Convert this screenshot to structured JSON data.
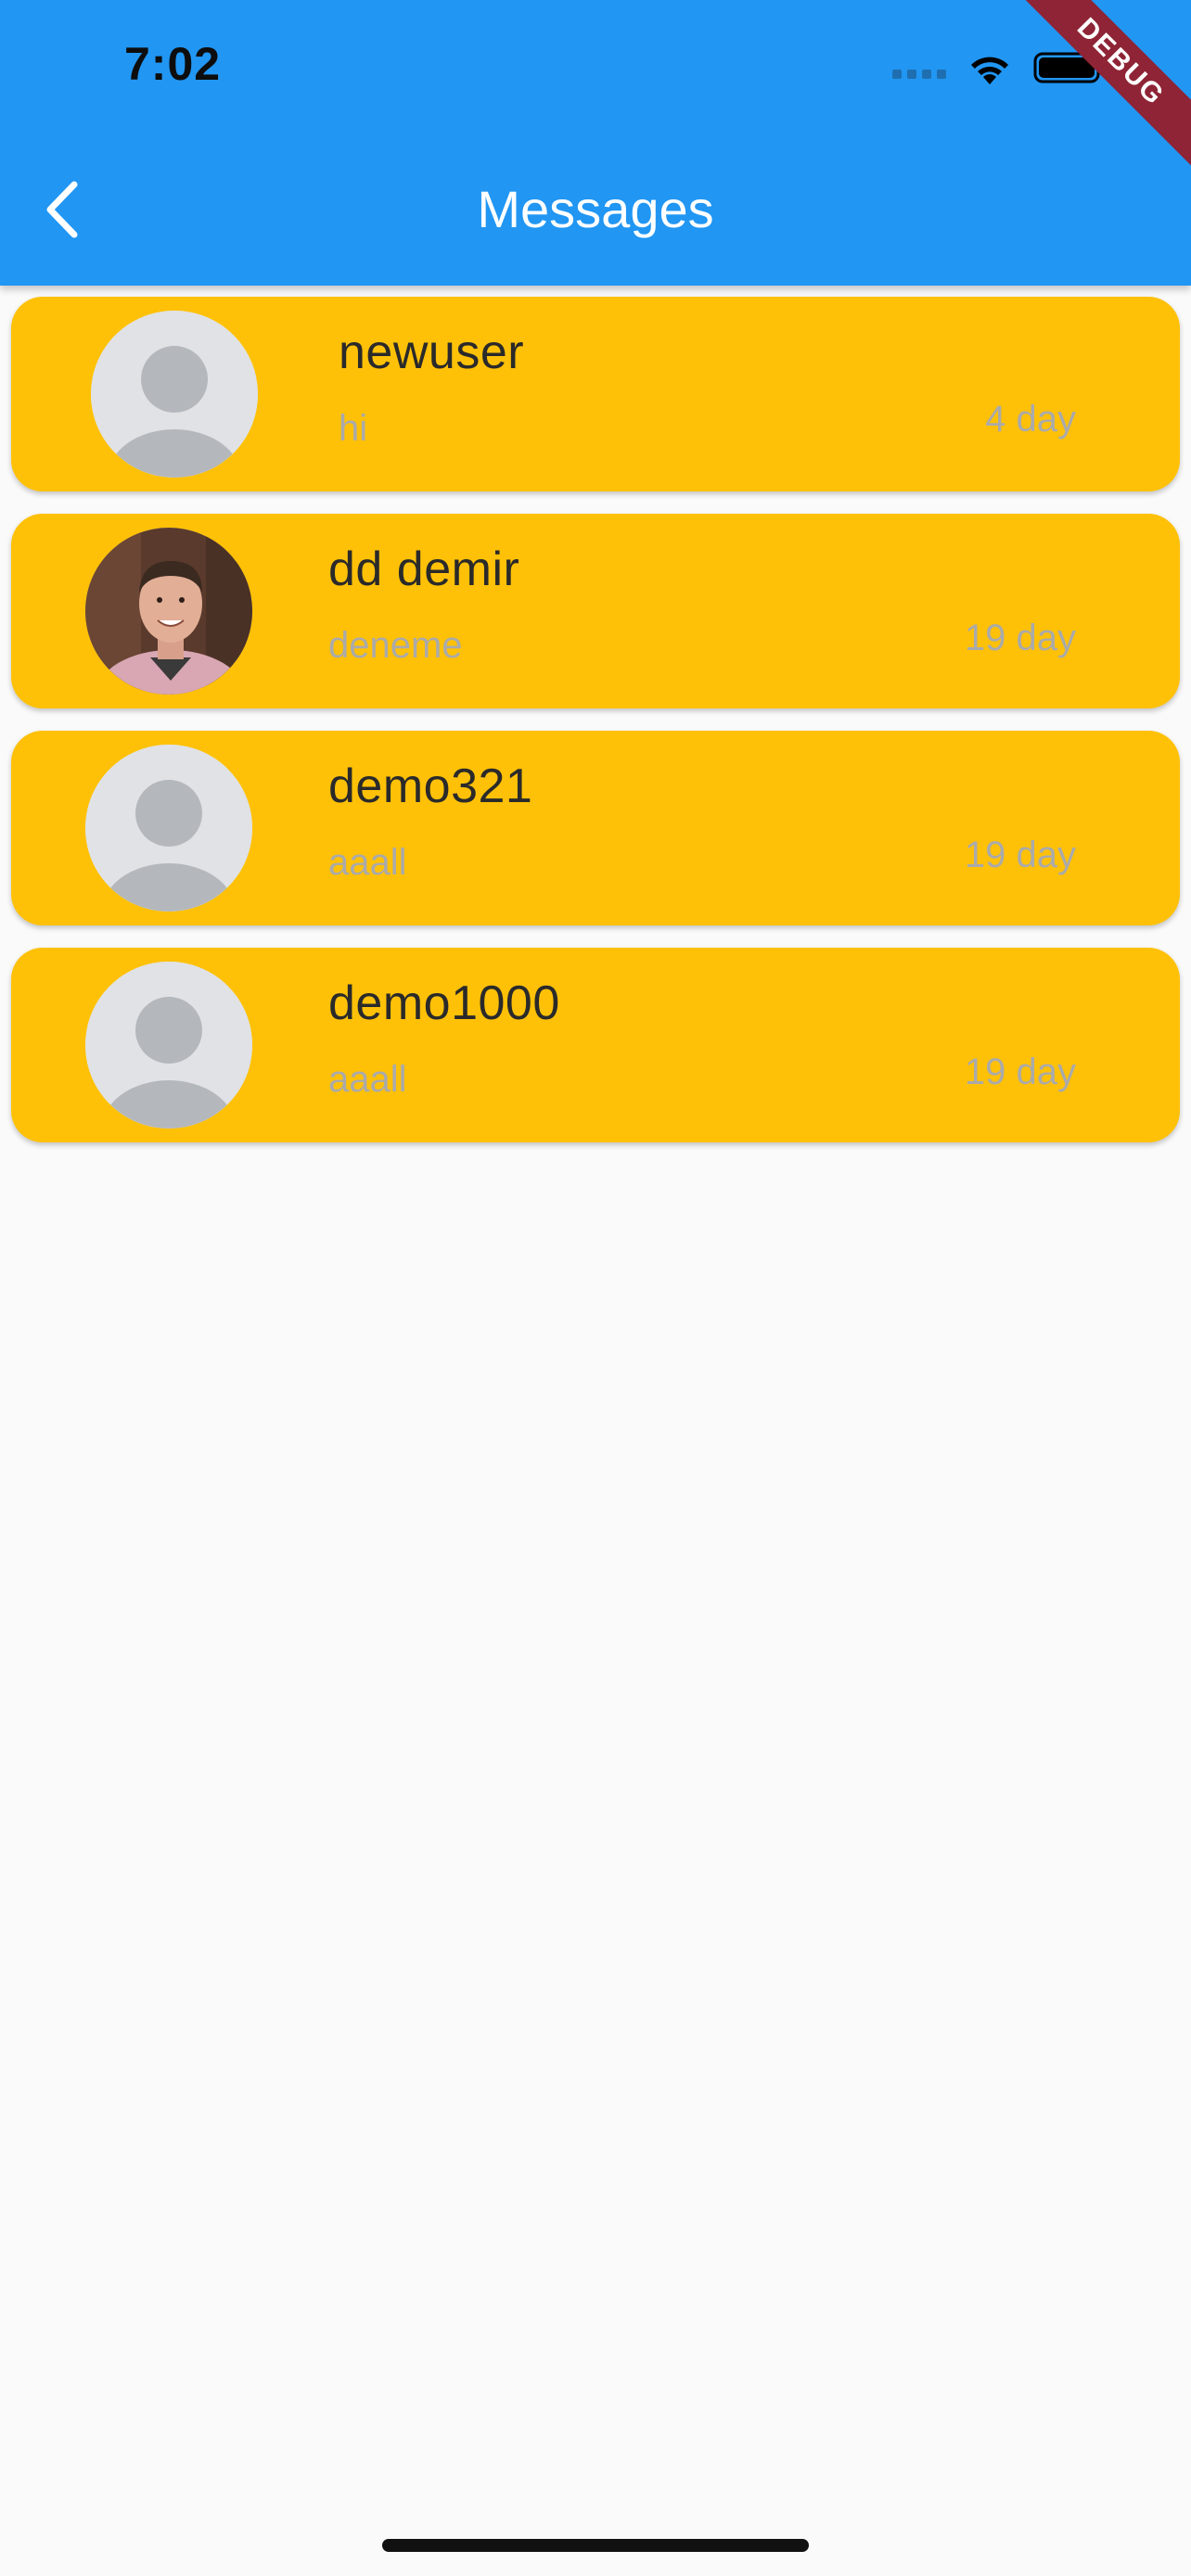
{
  "status_bar": {
    "time": "7:02"
  },
  "appbar": {
    "title": "Messages",
    "color": "#2196f3"
  },
  "debug_banner": "DEBUG",
  "conversations": [
    {
      "name": "newuser",
      "preview": "hi",
      "time": "4 day",
      "avatar": "default-avatar-icon"
    },
    {
      "name": "dd demir",
      "preview": "deneme",
      "time": "19 day",
      "avatar": "user-photo"
    },
    {
      "name": "demo321",
      "preview": "aaall",
      "time": "19 day",
      "avatar": "default-avatar-icon"
    },
    {
      "name": "demo1000",
      "preview": "aaall",
      "time": "19 day",
      "avatar": "default-avatar-icon"
    }
  ],
  "colors": {
    "card": "#ffc107",
    "background": "#fafafa"
  }
}
